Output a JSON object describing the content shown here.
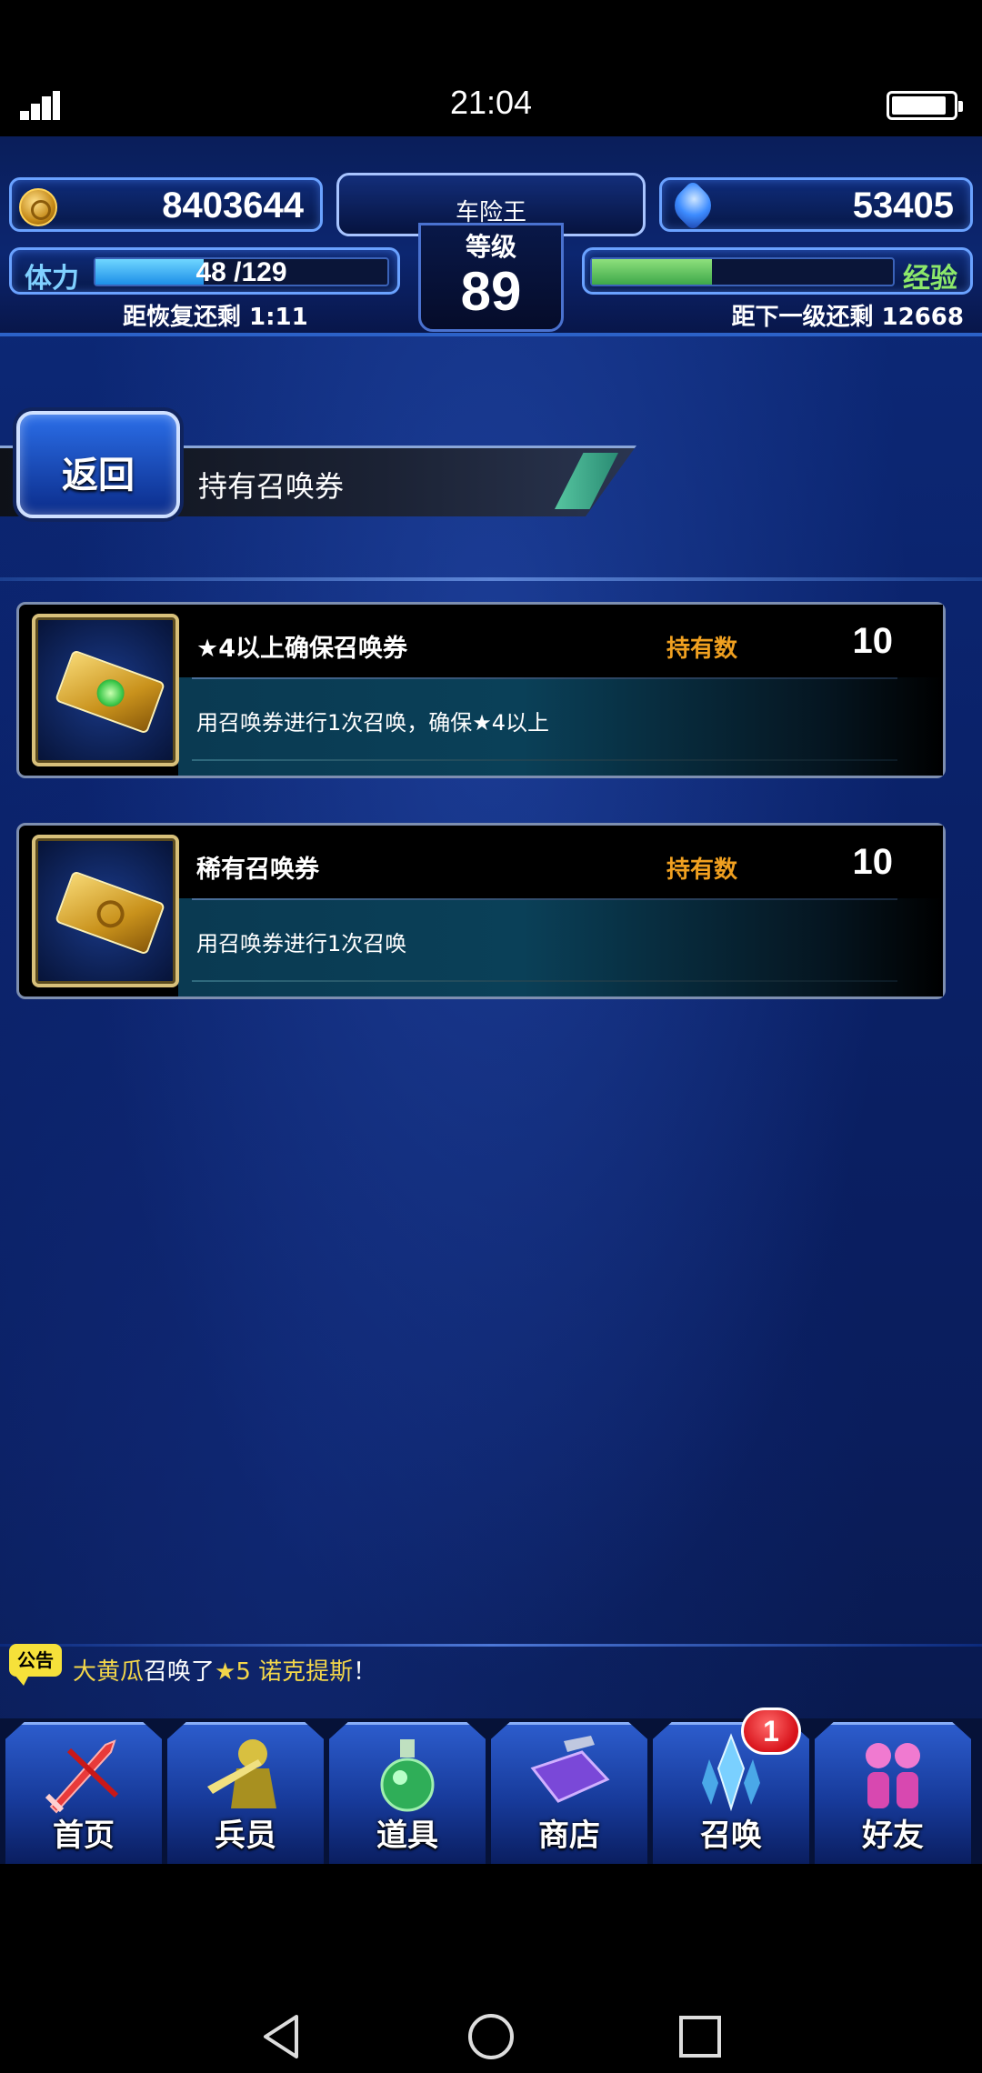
{
  "status_bar": {
    "time": "21:04"
  },
  "hud": {
    "gold": "8403644",
    "gems": "53405",
    "player_name": "车险王",
    "level_label": "等级",
    "level": "89",
    "stamina_label": "体力",
    "stamina_text": "48 /129",
    "stamina_current": 48,
    "stamina_max": 129,
    "recover_text": "距恢复还剩  1:11",
    "exp_label": "经验",
    "exp_fraction": 0.4,
    "next_level_text": "距下一级还剩  12668"
  },
  "header": {
    "back_label": "返回",
    "title": "持有召唤券"
  },
  "tickets": [
    {
      "name": "★4以上确保召唤券",
      "owned_label": "持有数",
      "count": "10",
      "description": "用召唤券进行1次召唤，确保★4以上"
    },
    {
      "name": "稀有召唤券",
      "owned_label": "持有数",
      "count": "10",
      "description": "用召唤券进行1次召唤"
    }
  ],
  "announcement": {
    "badge": "公告",
    "user": "大黄瓜",
    "middle": "召唤了",
    "star": "★5",
    "unit": " 诺克提斯",
    "tail": "！"
  },
  "nav": {
    "items": [
      {
        "label": "首页"
      },
      {
        "label": "兵员"
      },
      {
        "label": "道具"
      },
      {
        "label": "商店"
      },
      {
        "label": "召唤"
      },
      {
        "label": "好友"
      }
    ],
    "summon_badge": "1"
  },
  "colors": {
    "accent_gold": "#f0a020",
    "hud_border": "#6aa2ff",
    "stamina": "#1d8fe8",
    "exp": "#3ea84a"
  }
}
